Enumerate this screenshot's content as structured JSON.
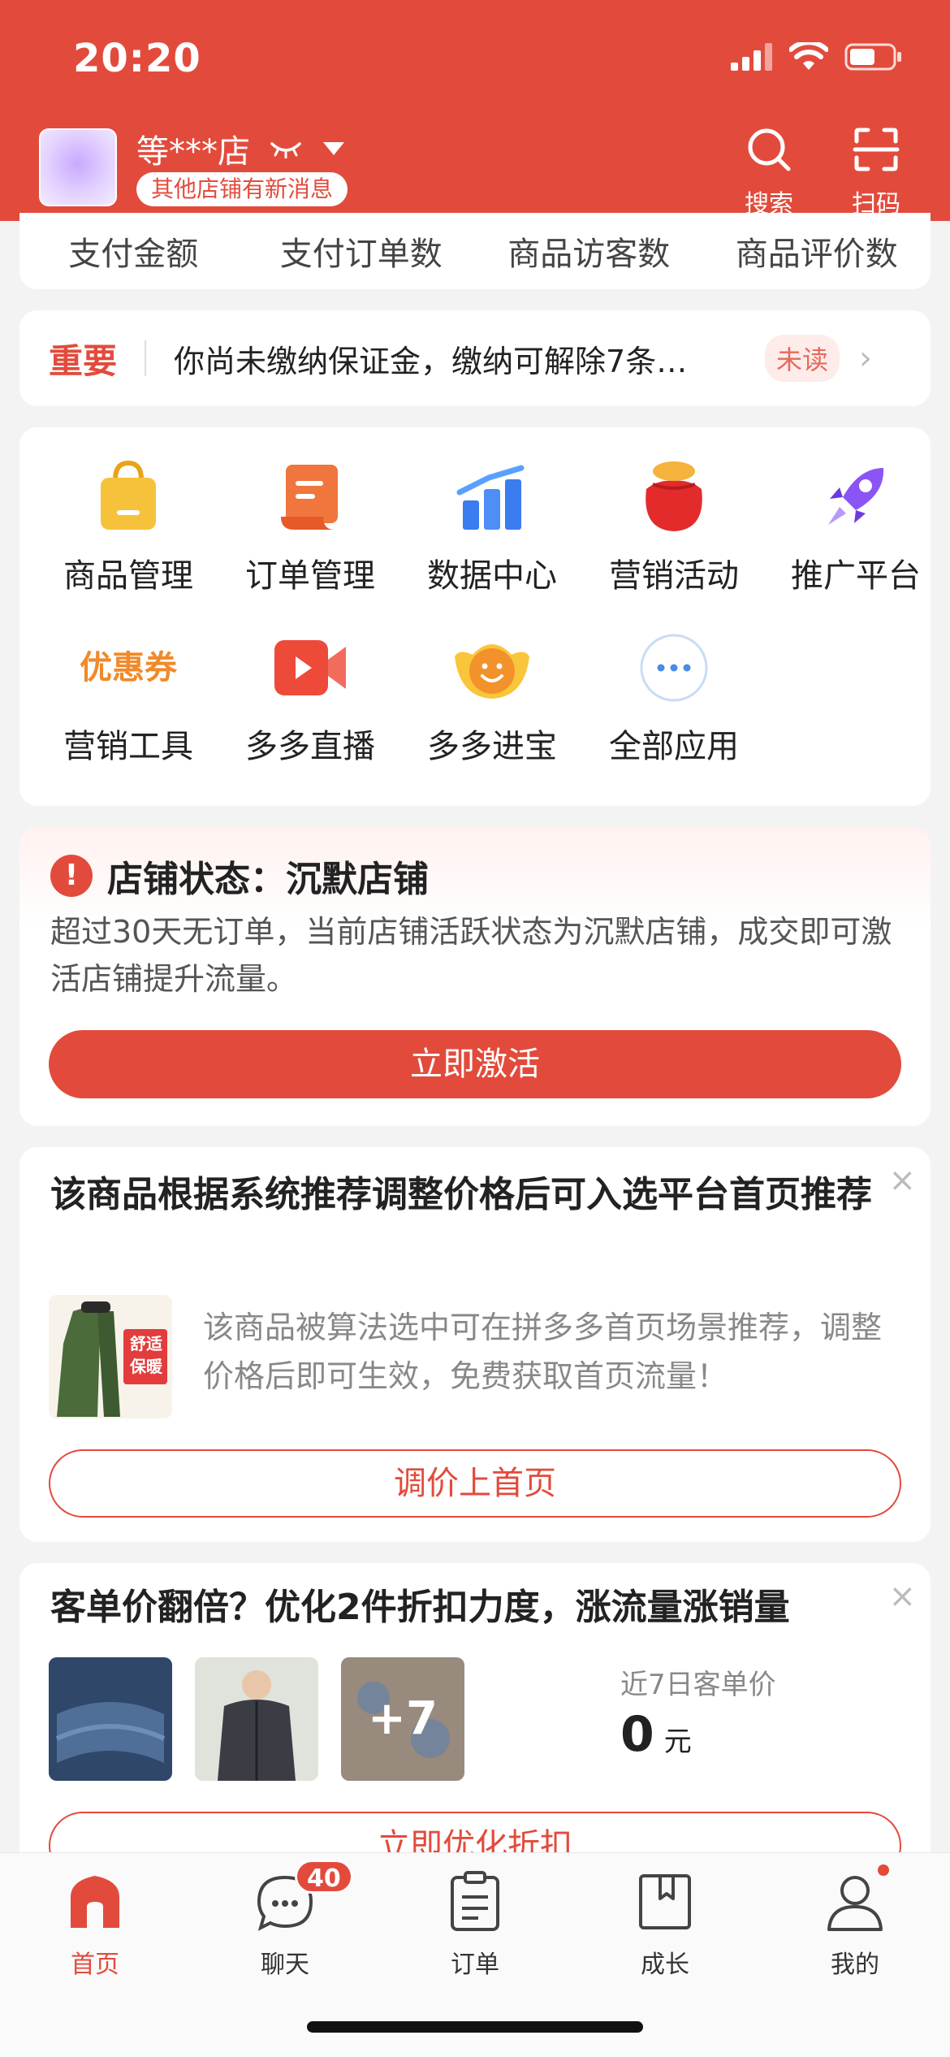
{
  "status_bar": {
    "time": "20:20"
  },
  "header": {
    "store_name": "等***店",
    "store_badge": "其他店铺有新消息",
    "search_label": "搜索",
    "scan_label": "扫码",
    "accent_color": "#e24b3c"
  },
  "metrics": [
    "支付金额",
    "支付订单数",
    "商品访客数",
    "商品评价数"
  ],
  "notice": {
    "tag": "重要",
    "text": "你尚未缴纳保证金，缴纳可解除7条…",
    "unread": "未读"
  },
  "apps": [
    {
      "label": "商品管理",
      "icon": "shopping-bag-icon"
    },
    {
      "label": "订单管理",
      "icon": "scroll-icon"
    },
    {
      "label": "数据中心",
      "icon": "bar-chart-icon"
    },
    {
      "label": "营销活动",
      "icon": "lucky-bag-icon"
    },
    {
      "label": "推广平台",
      "icon": "rocket-icon"
    },
    {
      "label": "营销工具",
      "icon": "coupon-icon",
      "icon_text": "优惠券"
    },
    {
      "label": "多多直播",
      "icon": "live-video-icon"
    },
    {
      "label": "多多进宝",
      "icon": "ingot-icon"
    },
    {
      "label": "全部应用",
      "icon": "more-dots-icon"
    }
  ],
  "store_status": {
    "title": "店铺状态：沉默店铺",
    "description": "超过30天无订单，当前店铺活跃状态为沉默店铺，成交即可激活店铺提升流量。",
    "button": "立即激活"
  },
  "price_recommendation": {
    "title": "该商品根据系统推荐调整价格后可入选平台首页推荐",
    "description": "该商品被算法选中可在拼多多首页场景推荐，调整价格后即可生效，免费获取首页流量！",
    "thumb_text": "舒适保暖",
    "button": "调价上首页"
  },
  "aov": {
    "title": "客单价翻倍？优化2件折扣力度，涨流量涨销量",
    "more_count": "+7",
    "label": "近7日客单价",
    "value": "0",
    "unit": "元",
    "button": "立即优化折扣"
  },
  "tabs": [
    {
      "label": "首页",
      "icon": "home-icon",
      "active": true
    },
    {
      "label": "聊天",
      "icon": "chat-bubble-icon",
      "badge": "40"
    },
    {
      "label": "订单",
      "icon": "clipboard-icon"
    },
    {
      "label": "成长",
      "icon": "book-icon"
    },
    {
      "label": "我的",
      "icon": "user-icon"
    }
  ]
}
